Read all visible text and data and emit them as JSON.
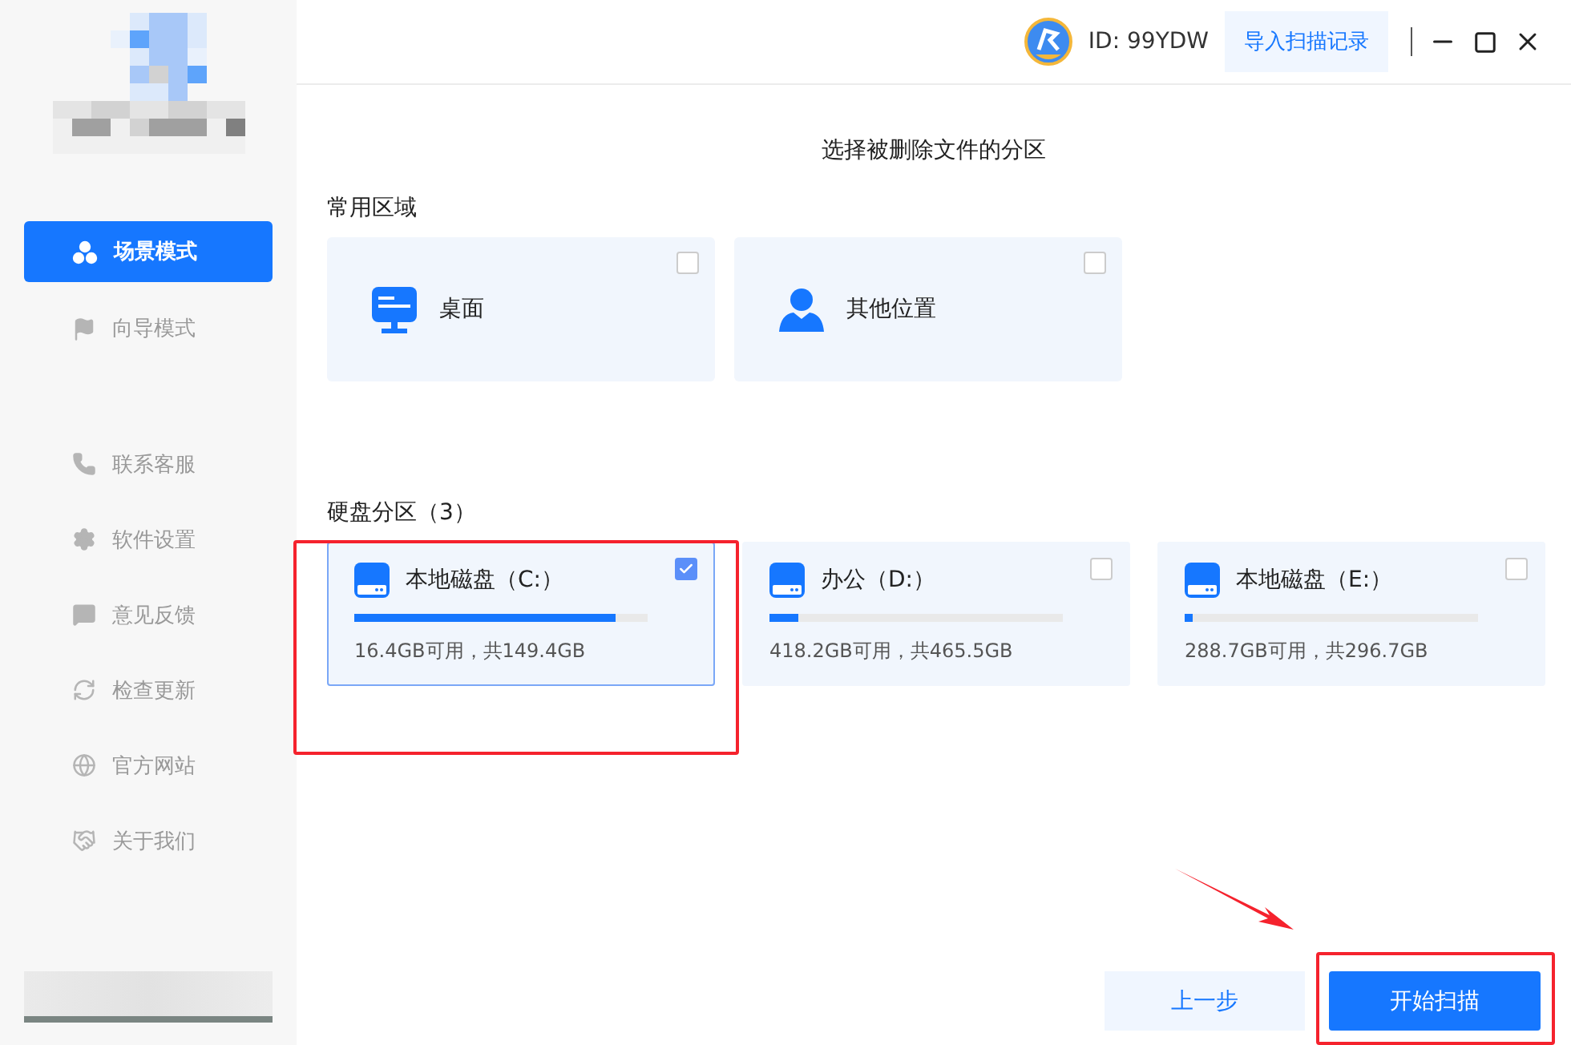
{
  "sidebar": {
    "modes": [
      {
        "label": "场景模式",
        "kind": "scene",
        "selected": true
      },
      {
        "label": "向导模式",
        "kind": "guide",
        "selected": false
      }
    ],
    "links": [
      {
        "label": "联系客服",
        "kind": "phone"
      },
      {
        "label": "软件设置",
        "kind": "settings"
      },
      {
        "label": "意见反馈",
        "kind": "feedback"
      },
      {
        "label": "检查更新",
        "kind": "update"
      },
      {
        "label": "官方网站",
        "kind": "web"
      },
      {
        "label": "关于我们",
        "kind": "about"
      }
    ]
  },
  "header": {
    "user_id": "ID: 99YDW",
    "import_button": "导入扫描记录"
  },
  "title": "选择被删除文件的分区",
  "common_section": {
    "heading": "常用区域",
    "locations": [
      {
        "label": "桌面",
        "kind": "desktop",
        "checked": false
      },
      {
        "label": "其他位置",
        "kind": "other",
        "checked": false
      }
    ]
  },
  "disk_section": {
    "heading": "硬盘分区（3）",
    "disks": [
      {
        "name": "本地磁盘（C:）",
        "usage": "16.4GB可用，共149.4GB",
        "level": 0.89,
        "checked": true
      },
      {
        "name": "办公（D:）",
        "usage": "418.2GB可用，共465.5GB",
        "level": 0.1,
        "checked": false
      },
      {
        "name": "本地磁盘（E:）",
        "usage": "288.7GB可用，共296.7GB",
        "level": 0.03,
        "checked": false
      }
    ]
  },
  "buttons": {
    "back": "上一步",
    "start": "开始扫描"
  }
}
